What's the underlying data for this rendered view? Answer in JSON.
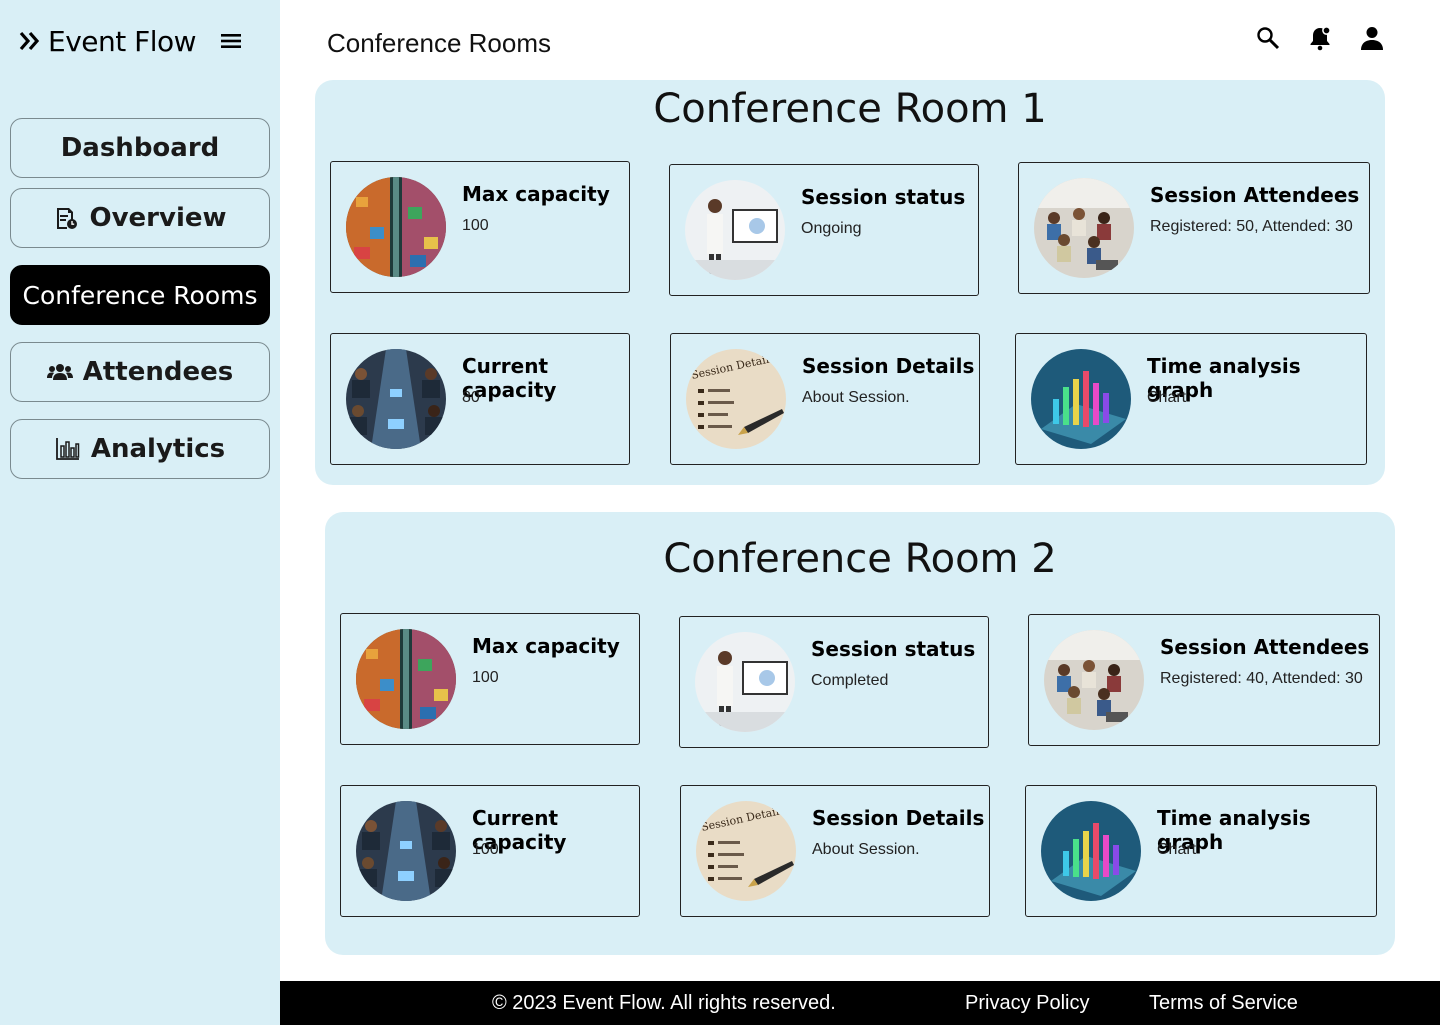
{
  "app": {
    "name": "Event Flow"
  },
  "nav": {
    "items": [
      {
        "label": "Dashboard"
      },
      {
        "label": "Overview"
      },
      {
        "label": "Conference Rooms"
      },
      {
        "label": "Attendees"
      },
      {
        "label": "Analytics"
      }
    ],
    "active": "Conference Rooms"
  },
  "header": {
    "title": "Conference Rooms"
  },
  "rooms": [
    {
      "title": "Conference Room 1",
      "cards": [
        {
          "title": "Max capacity",
          "value": "100"
        },
        {
          "title": "Session status",
          "value": "Ongoing"
        },
        {
          "title": "Session Attendees",
          "value": "Registered: 50, Attended: 30"
        },
        {
          "title": "Current capacity",
          "value": "80"
        },
        {
          "title": "Session Details",
          "value": "About Session."
        },
        {
          "title": "Time analysis graph",
          "value": "Chart"
        }
      ]
    },
    {
      "title": "Conference Room 2",
      "cards": [
        {
          "title": "Max capacity",
          "value": "100"
        },
        {
          "title": "Session status",
          "value": "Completed"
        },
        {
          "title": "Session Attendees",
          "value": "Registered: 40, Attended: 30"
        },
        {
          "title": "Current capacity",
          "value": "100"
        },
        {
          "title": "Session Details",
          "value": "About Session."
        },
        {
          "title": "Time analysis graph",
          "value": "Chart"
        }
      ]
    }
  ],
  "footer": {
    "copyright": "© 2023 Event Flow. All rights reserved.",
    "privacy": "Privacy Policy",
    "terms": "Terms of Service"
  },
  "icons": {
    "brand": "double-chevron-right-icon",
    "menu": "hamburger-icon",
    "search": "search-icon",
    "notifications": "bell-icon",
    "account": "user-icon"
  },
  "colors": {
    "panel": "#d9eff6",
    "active_nav": "#000000",
    "footer": "#000000"
  }
}
